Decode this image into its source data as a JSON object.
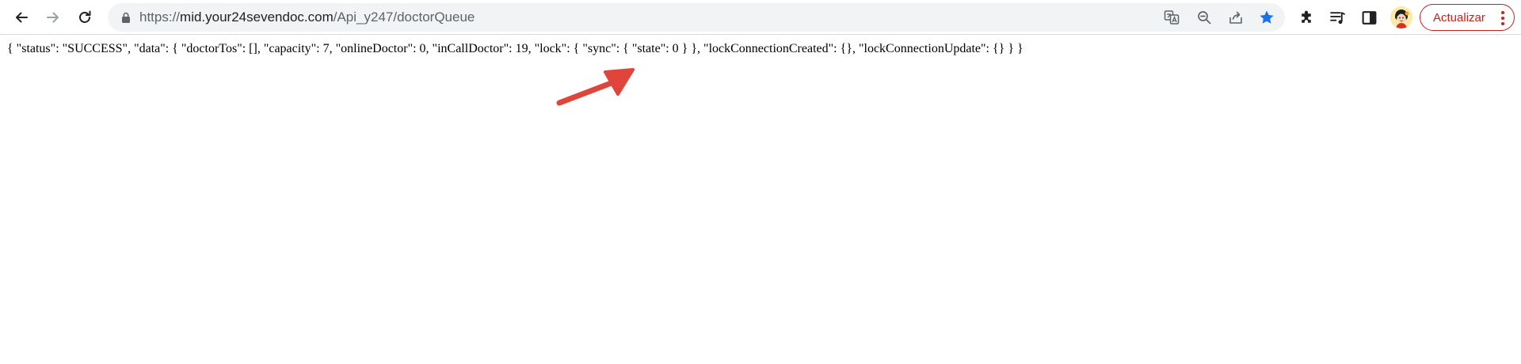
{
  "browser": {
    "url": {
      "scheme": "https://",
      "host": "mid.your24sevendoc.com",
      "path": "/Api_y247/doctorQueue"
    },
    "update_button_label": "Actualizar",
    "bookmark_star_color": "#1a73e8",
    "accent_color": "#c5221f"
  },
  "page": {
    "json_text": "{ \"status\": \"SUCCESS\", \"data\": { \"doctorTos\": [], \"capacity\": 7, \"onlineDoctor\": 0, \"inCallDoctor\": 19, \"lock\": { \"sync\": { \"state\": 0 } }, \"lockConnectionCreated\": {}, \"lockConnectionUpdate\": {} } }"
  },
  "annotation": {
    "color": "#e0443a"
  },
  "icons": {
    "back": "back-arrow-icon",
    "forward": "forward-arrow-icon",
    "reload": "reload-icon",
    "lock": "lock-icon",
    "translate": "translate-icon",
    "zoom": "zoom-out-icon",
    "share": "share-icon",
    "bookmark": "star-icon",
    "extensions": "puzzle-icon",
    "media": "media-queue-icon",
    "side_panel": "side-panel-icon",
    "profile": "avatar"
  }
}
